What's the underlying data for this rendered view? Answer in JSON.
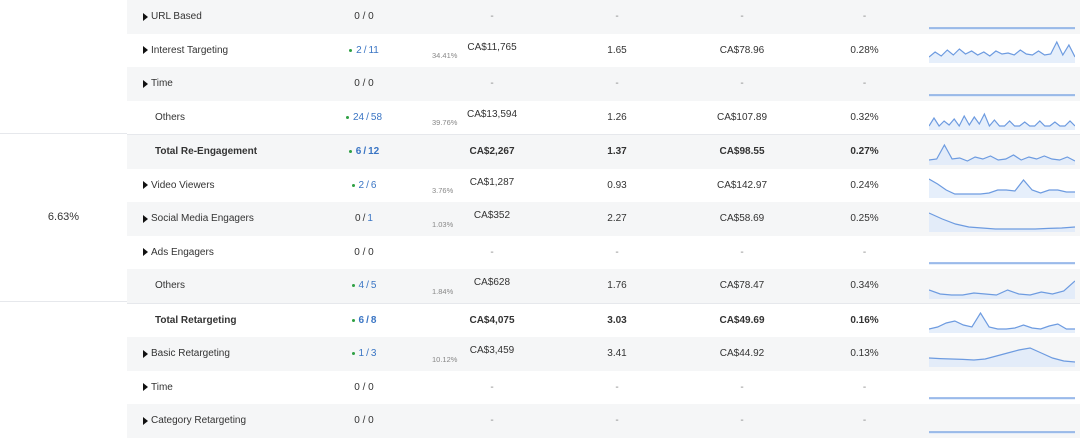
{
  "left_panel": {
    "value": "6.63%"
  },
  "rows": [
    {
      "label": "URL Based",
      "expander": true,
      "indent": false,
      "total": false,
      "alt": true,
      "count": {
        "plain": "0 / 0"
      },
      "pct": "",
      "spend": "-",
      "freq": "-",
      "cpm": "-",
      "ctr": "-",
      "spark": [
        0,
        0,
        0,
        0,
        0,
        0,
        0,
        0,
        0,
        0
      ]
    },
    {
      "label": "Interest Targeting",
      "expander": true,
      "indent": false,
      "total": false,
      "alt": false,
      "count": {
        "dot": true,
        "num": "2",
        "den": "11"
      },
      "pct": "34.41%",
      "spend": "CA$11,765",
      "freq": "1.65",
      "cpm": "CA$78.96",
      "ctr": "0.28%",
      "spark": [
        0.2,
        0.45,
        0.25,
        0.55,
        0.3,
        0.6,
        0.35,
        0.5,
        0.3,
        0.45,
        0.25,
        0.5,
        0.35,
        0.4,
        0.3,
        0.55,
        0.35,
        0.3,
        0.5,
        0.3,
        0.35,
        0.95,
        0.3,
        0.8,
        0.2
      ]
    },
    {
      "label": "Time",
      "expander": true,
      "indent": false,
      "total": false,
      "alt": true,
      "count": {
        "plain": "0 / 0"
      },
      "pct": "",
      "spend": "-",
      "freq": "-",
      "cpm": "-",
      "ctr": "-",
      "spark": [
        0,
        0,
        0,
        0,
        0,
        0,
        0,
        0,
        0,
        0
      ]
    },
    {
      "label": "Others",
      "expander": false,
      "indent": true,
      "total": false,
      "alt": false,
      "count": {
        "dot": true,
        "num": "24",
        "den": "58"
      },
      "pct": "39.76%",
      "spend": "CA$13,594",
      "freq": "1.26",
      "cpm": "CA$107.89",
      "ctr": "0.32%",
      "spark": [
        0.1,
        0.5,
        0.1,
        0.35,
        0.15,
        0.45,
        0.1,
        0.6,
        0.15,
        0.55,
        0.2,
        0.7,
        0.1,
        0.4,
        0.1,
        0.1,
        0.35,
        0.1,
        0.1,
        0.3,
        0.1,
        0.1,
        0.35,
        0.1,
        0.1,
        0.3,
        0.1,
        0.1,
        0.35,
        0.1
      ]
    },
    {
      "label": "Total Re-Engagement",
      "expander": false,
      "indent": true,
      "total": true,
      "alt": true,
      "count": {
        "dot": true,
        "num": "6",
        "den": "12"
      },
      "pct": "",
      "spend": "CA$2,267",
      "freq": "1.37",
      "cpm": "CA$98.55",
      "ctr": "0.27%",
      "spark": [
        0.15,
        0.2,
        0.9,
        0.2,
        0.25,
        0.1,
        0.3,
        0.2,
        0.35,
        0.15,
        0.2,
        0.4,
        0.15,
        0.3,
        0.2,
        0.35,
        0.2,
        0.15,
        0.3,
        0.1
      ]
    },
    {
      "label": "Video Viewers",
      "expander": true,
      "indent": false,
      "total": false,
      "alt": false,
      "count": {
        "dot": true,
        "num": "2",
        "den": "6"
      },
      "pct": "3.76%",
      "spend": "CA$1,287",
      "freq": "0.93",
      "cpm": "CA$142.97",
      "ctr": "0.24%",
      "spark": [
        0.85,
        0.6,
        0.3,
        0.1,
        0.1,
        0.1,
        0.1,
        0.15,
        0.3,
        0.3,
        0.25,
        0.8,
        0.3,
        0.15,
        0.3,
        0.3,
        0.2,
        0.2
      ]
    },
    {
      "label": "Social Media Engagers",
      "expander": true,
      "indent": false,
      "total": false,
      "alt": true,
      "count": {
        "plain_num": "0",
        "den": "1"
      },
      "pct": "1.03%",
      "spend": "CA$352",
      "freq": "2.27",
      "cpm": "CA$58.69",
      "ctr": "0.25%",
      "spark": [
        0.85,
        0.55,
        0.3,
        0.15,
        0.1,
        0.05,
        0.05,
        0.05,
        0.05,
        0.08,
        0.1,
        0.15
      ]
    },
    {
      "label": "Ads Engagers",
      "expander": true,
      "indent": false,
      "total": false,
      "alt": false,
      "count": {
        "plain": "0 / 0"
      },
      "pct": "",
      "spend": "-",
      "freq": "-",
      "cpm": "-",
      "ctr": "-",
      "spark": [
        0,
        0,
        0,
        0,
        0,
        0,
        0,
        0,
        0,
        0
      ]
    },
    {
      "label": "Others",
      "expander": false,
      "indent": true,
      "total": false,
      "alt": true,
      "count": {
        "dot": true,
        "num": "4",
        "den": "5"
      },
      "pct": "1.84%",
      "spend": "CA$628",
      "freq": "1.76",
      "cpm": "CA$78.47",
      "ctr": "0.34%",
      "spark": [
        0.35,
        0.15,
        0.1,
        0.1,
        0.2,
        0.15,
        0.1,
        0.35,
        0.15,
        0.1,
        0.25,
        0.15,
        0.3,
        0.8
      ]
    },
    {
      "label": "Total Retargeting",
      "expander": false,
      "indent": true,
      "total": true,
      "alt": false,
      "count": {
        "dot": true,
        "num": "6",
        "den": "8"
      },
      "pct": "",
      "spend": "CA$4,075",
      "freq": "3.03",
      "cpm": "CA$49.69",
      "ctr": "0.16%",
      "spark": [
        0.1,
        0.2,
        0.4,
        0.5,
        0.3,
        0.2,
        0.9,
        0.2,
        0.1,
        0.1,
        0.15,
        0.3,
        0.15,
        0.1,
        0.25,
        0.35,
        0.1,
        0.1
      ]
    },
    {
      "label": "Basic Retargeting",
      "expander": true,
      "indent": false,
      "total": false,
      "alt": true,
      "count": {
        "dot": true,
        "num": "1",
        "den": "3"
      },
      "pct": "10.12%",
      "spend": "CA$3,459",
      "freq": "3.41",
      "cpm": "CA$44.92",
      "ctr": "0.13%",
      "spark": [
        0.35,
        0.32,
        0.3,
        0.28,
        0.25,
        0.3,
        0.45,
        0.6,
        0.75,
        0.85,
        0.6,
        0.35,
        0.2,
        0.15
      ]
    },
    {
      "label": "Time",
      "expander": true,
      "indent": false,
      "total": false,
      "alt": false,
      "count": {
        "plain": "0 / 0"
      },
      "pct": "",
      "spend": "-",
      "freq": "-",
      "cpm": "-",
      "ctr": "-",
      "spark": [
        0,
        0,
        0,
        0,
        0,
        0,
        0,
        0,
        0,
        0
      ]
    },
    {
      "label": "Category Retargeting",
      "expander": true,
      "indent": false,
      "total": false,
      "alt": true,
      "count": {
        "plain": "0 / 0"
      },
      "pct": "",
      "spend": "-",
      "freq": "-",
      "cpm": "-",
      "ctr": "-",
      "spark": [
        0,
        0,
        0,
        0,
        0,
        0,
        0,
        0,
        0,
        0
      ]
    }
  ],
  "colors": {
    "spark_line": "#6d9be0",
    "spark_fill": "#dbe8fa",
    "accent_blue": "#3a75c4",
    "status_green": "#2ea043"
  }
}
